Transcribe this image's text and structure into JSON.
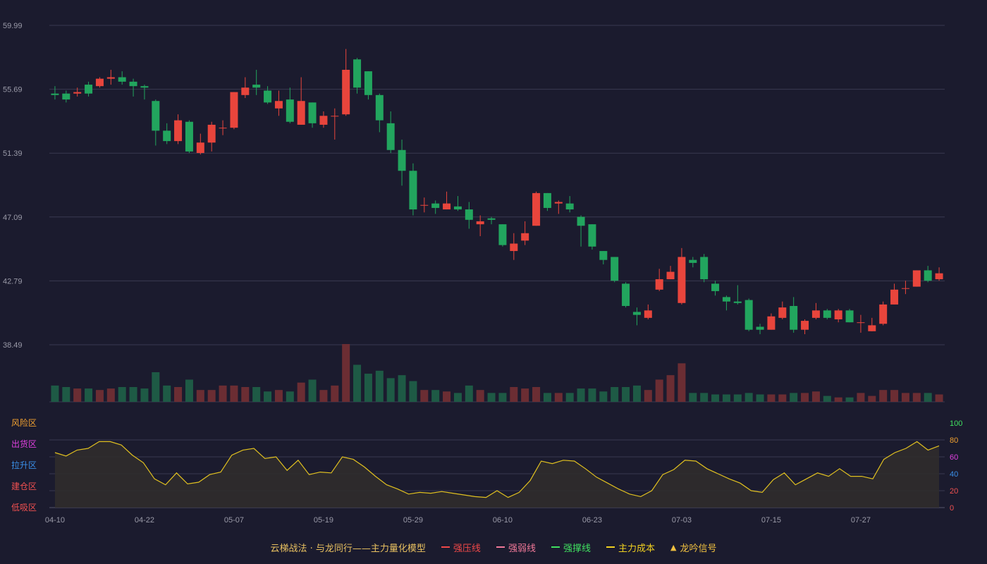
{
  "colors": {
    "background": "#1b1b2e",
    "up": "#e8453c",
    "down": "#22a55e",
    "volume_up": "#6b2d33",
    "volume_down": "#1e5a45",
    "grid": "#3a3a50",
    "axis_text": "#9a9aa8",
    "score_line": "#e0c020",
    "score_fill": "#302c2c"
  },
  "chart_data": [
    {
      "type": "candlestick",
      "name": "price",
      "y_ticks": [
        "59.99",
        "55.69",
        "51.39",
        "47.09",
        "42.79",
        "38.49"
      ],
      "ylim": [
        38.49,
        59.99
      ],
      "grid": true,
      "x_labels": [
        "04-10",
        "04-22",
        "05-07",
        "05-19",
        "05-29",
        "06-10",
        "06-23",
        "07-03",
        "07-15",
        "07-27"
      ],
      "x_label_index": [
        0,
        8,
        16,
        24,
        32,
        40,
        48,
        56,
        64,
        72
      ],
      "candles": [
        [
          55.4,
          55.3,
          55.9,
          55.0
        ],
        [
          55.4,
          55.0,
          55.6,
          54.8
        ],
        [
          55.4,
          55.5,
          55.8,
          55.2
        ],
        [
          56.0,
          55.4,
          56.2,
          55.2
        ],
        [
          55.9,
          56.4,
          56.5,
          55.8
        ],
        [
          56.4,
          56.5,
          57.0,
          56.0
        ],
        [
          56.5,
          56.2,
          56.9,
          56.0
        ],
        [
          56.2,
          55.9,
          56.4,
          55.2
        ],
        [
          55.9,
          55.8,
          56.0,
          55.0
        ],
        [
          54.9,
          52.9,
          55.0,
          51.9
        ],
        [
          52.9,
          52.2,
          53.4,
          52.0
        ],
        [
          52.2,
          53.6,
          54.0,
          52.0
        ],
        [
          53.5,
          51.5,
          53.6,
          51.4
        ],
        [
          51.4,
          52.1,
          52.7,
          51.3
        ],
        [
          52.1,
          53.3,
          53.5,
          51.5
        ],
        [
          53.1,
          53.1,
          53.6,
          52.6
        ],
        [
          53.1,
          55.5,
          55.5,
          53.0
        ],
        [
          55.3,
          55.8,
          56.5,
          55.1
        ],
        [
          56.0,
          55.8,
          57.0,
          55.3
        ],
        [
          55.6,
          54.8,
          55.9,
          54.7
        ],
        [
          54.4,
          54.9,
          55.6,
          53.9
        ],
        [
          55.0,
          53.5,
          55.8,
          53.4
        ],
        [
          53.3,
          54.9,
          56.5,
          53.3
        ],
        [
          54.8,
          53.4,
          54.8,
          53.1
        ],
        [
          53.3,
          53.9,
          54.2,
          53.1
        ],
        [
          53.9,
          53.9,
          54.4,
          52.3
        ],
        [
          54.0,
          57.0,
          58.4,
          53.9
        ],
        [
          57.7,
          55.8,
          57.8,
          55.4
        ],
        [
          56.9,
          55.3,
          56.9,
          55.0
        ],
        [
          55.3,
          53.6,
          55.4,
          52.8
        ],
        [
          53.4,
          51.6,
          54.2,
          51.4
        ],
        [
          51.6,
          50.2,
          52.3,
          49.2
        ],
        [
          50.2,
          47.6,
          50.7,
          47.2
        ],
        [
          47.9,
          47.9,
          48.4,
          47.4
        ],
        [
          48.0,
          47.7,
          48.2,
          47.3
        ],
        [
          47.6,
          48.0,
          48.8,
          47.6
        ],
        [
          47.8,
          47.6,
          48.5,
          47.5
        ],
        [
          47.6,
          46.9,
          48.1,
          46.3
        ],
        [
          46.6,
          46.8,
          47.2,
          45.8
        ],
        [
          47.0,
          46.9,
          47.1,
          46.6
        ],
        [
          46.6,
          45.2,
          46.6,
          45.1
        ],
        [
          44.8,
          45.3,
          46.0,
          44.2
        ],
        [
          45.5,
          46.0,
          46.8,
          45.2
        ],
        [
          46.5,
          48.7,
          48.8,
          46.5
        ],
        [
          48.7,
          47.7,
          48.7,
          47.5
        ],
        [
          48.0,
          48.1,
          48.2,
          47.3
        ],
        [
          48.0,
          47.6,
          48.5,
          47.4
        ],
        [
          47.1,
          46.5,
          47.2,
          45.1
        ],
        [
          46.6,
          45.1,
          46.6,
          44.9
        ],
        [
          44.8,
          44.2,
          44.8,
          43.9
        ],
        [
          44.4,
          42.8,
          44.4,
          42.7
        ],
        [
          42.6,
          41.1,
          42.7,
          41.0
        ],
        [
          40.7,
          40.5,
          41.0,
          39.8
        ],
        [
          40.3,
          40.8,
          41.2,
          40.2
        ],
        [
          42.2,
          42.9,
          43.6,
          42.1
        ],
        [
          42.9,
          43.4,
          43.8,
          42.9
        ],
        [
          41.3,
          44.4,
          45.0,
          41.2
        ],
        [
          44.2,
          44.0,
          44.4,
          43.7
        ],
        [
          44.4,
          42.9,
          44.6,
          42.7
        ],
        [
          42.6,
          42.1,
          42.8,
          41.8
        ],
        [
          41.7,
          41.4,
          41.8,
          40.8
        ],
        [
          41.4,
          41.3,
          42.5,
          41.2
        ],
        [
          41.5,
          39.5,
          41.6,
          39.4
        ],
        [
          39.7,
          39.5,
          39.9,
          39.2
        ],
        [
          39.5,
          40.4,
          40.6,
          39.5
        ],
        [
          40.3,
          41.0,
          41.4,
          40.2
        ],
        [
          41.1,
          39.5,
          41.7,
          39.3
        ],
        [
          39.5,
          40.1,
          40.2,
          39.2
        ],
        [
          40.3,
          40.8,
          41.3,
          40.2
        ],
        [
          40.8,
          40.3,
          40.9,
          40.2
        ],
        [
          40.2,
          40.8,
          40.9,
          40.0
        ],
        [
          40.8,
          40.0,
          40.9,
          40.0
        ],
        [
          40.0,
          40.0,
          40.5,
          39.3
        ],
        [
          39.4,
          39.8,
          40.3,
          39.4
        ],
        [
          39.9,
          41.2,
          41.4,
          39.8
        ],
        [
          41.2,
          42.2,
          42.6,
          41.2
        ],
        [
          42.3,
          42.3,
          42.8,
          41.9
        ],
        [
          42.4,
          43.5,
          43.5,
          42.4
        ],
        [
          43.5,
          42.8,
          43.8,
          42.7
        ],
        [
          42.9,
          43.3,
          43.7,
          42.8
        ]
      ],
      "volume": [
        11,
        10,
        9,
        9,
        8,
        9,
        10,
        10,
        9,
        20,
        11,
        10,
        15,
        8,
        8,
        11,
        11,
        10,
        10,
        7,
        8,
        7,
        13,
        15,
        8,
        11,
        39,
        25,
        19,
        21,
        16,
        18,
        14,
        8,
        8,
        7,
        6,
        11,
        8,
        6,
        6,
        10,
        9,
        10,
        6,
        6,
        6,
        9,
        9,
        7,
        10,
        10,
        11,
        8,
        15,
        18,
        26,
        6,
        6,
        5,
        5,
        5,
        6,
        5,
        5,
        5,
        6,
        6,
        7,
        4,
        3,
        3,
        6,
        4,
        8,
        8,
        6,
        6,
        6,
        5
      ]
    },
    {
      "type": "area",
      "name": "score",
      "ylim": [
        0,
        100
      ],
      "y_ticks": [
        "100",
        "80",
        "60",
        "40",
        "20",
        "0"
      ],
      "zones": [
        {
          "label": "风险区",
          "color": "#f0a030"
        },
        {
          "label": "出货区",
          "color": "#e040e0"
        },
        {
          "label": "拉升区",
          "color": "#3a8fe8"
        },
        {
          "label": "建仓区",
          "color": "#f05050"
        },
        {
          "label": "低吸区",
          "color": "#f05050"
        }
      ],
      "values": [
        65,
        61,
        68,
        70,
        78,
        78,
        74,
        62,
        53,
        34,
        27,
        41,
        28,
        30,
        39,
        42,
        62,
        68,
        70,
        58,
        60,
        44,
        56,
        39,
        42,
        41,
        60,
        57,
        48,
        37,
        27,
        22,
        16,
        18,
        17,
        19,
        17,
        15,
        13,
        12,
        20,
        12,
        18,
        32,
        55,
        52,
        56,
        55,
        46,
        36,
        29,
        22,
        16,
        13,
        20,
        39,
        45,
        56,
        55,
        46,
        40,
        34,
        29,
        20,
        18,
        33,
        41,
        27,
        34,
        41,
        37,
        46,
        37,
        37,
        34,
        57,
        65,
        70,
        78,
        68,
        73
      ]
    }
  ],
  "legend": {
    "title": "云梯战法 · 与龙同行——主力量化模型",
    "title_color": "#e8c060",
    "items": [
      {
        "label": "强压线",
        "color": "#f04848",
        "style": "solid",
        "icon": "line-icon"
      },
      {
        "label": "强弱线",
        "color": "#f07898",
        "style": "dashed",
        "icon": "line-icon"
      },
      {
        "label": "强撑线",
        "color": "#40e060",
        "style": "solid",
        "icon": "line-icon"
      },
      {
        "label": "主力成本",
        "color": "#f0d020",
        "style": "dashed",
        "icon": "line-icon"
      },
      {
        "label": "龙吟信号",
        "color": "#f0c040",
        "icon": "triangle-icon",
        "glyph": "▲"
      }
    ]
  }
}
